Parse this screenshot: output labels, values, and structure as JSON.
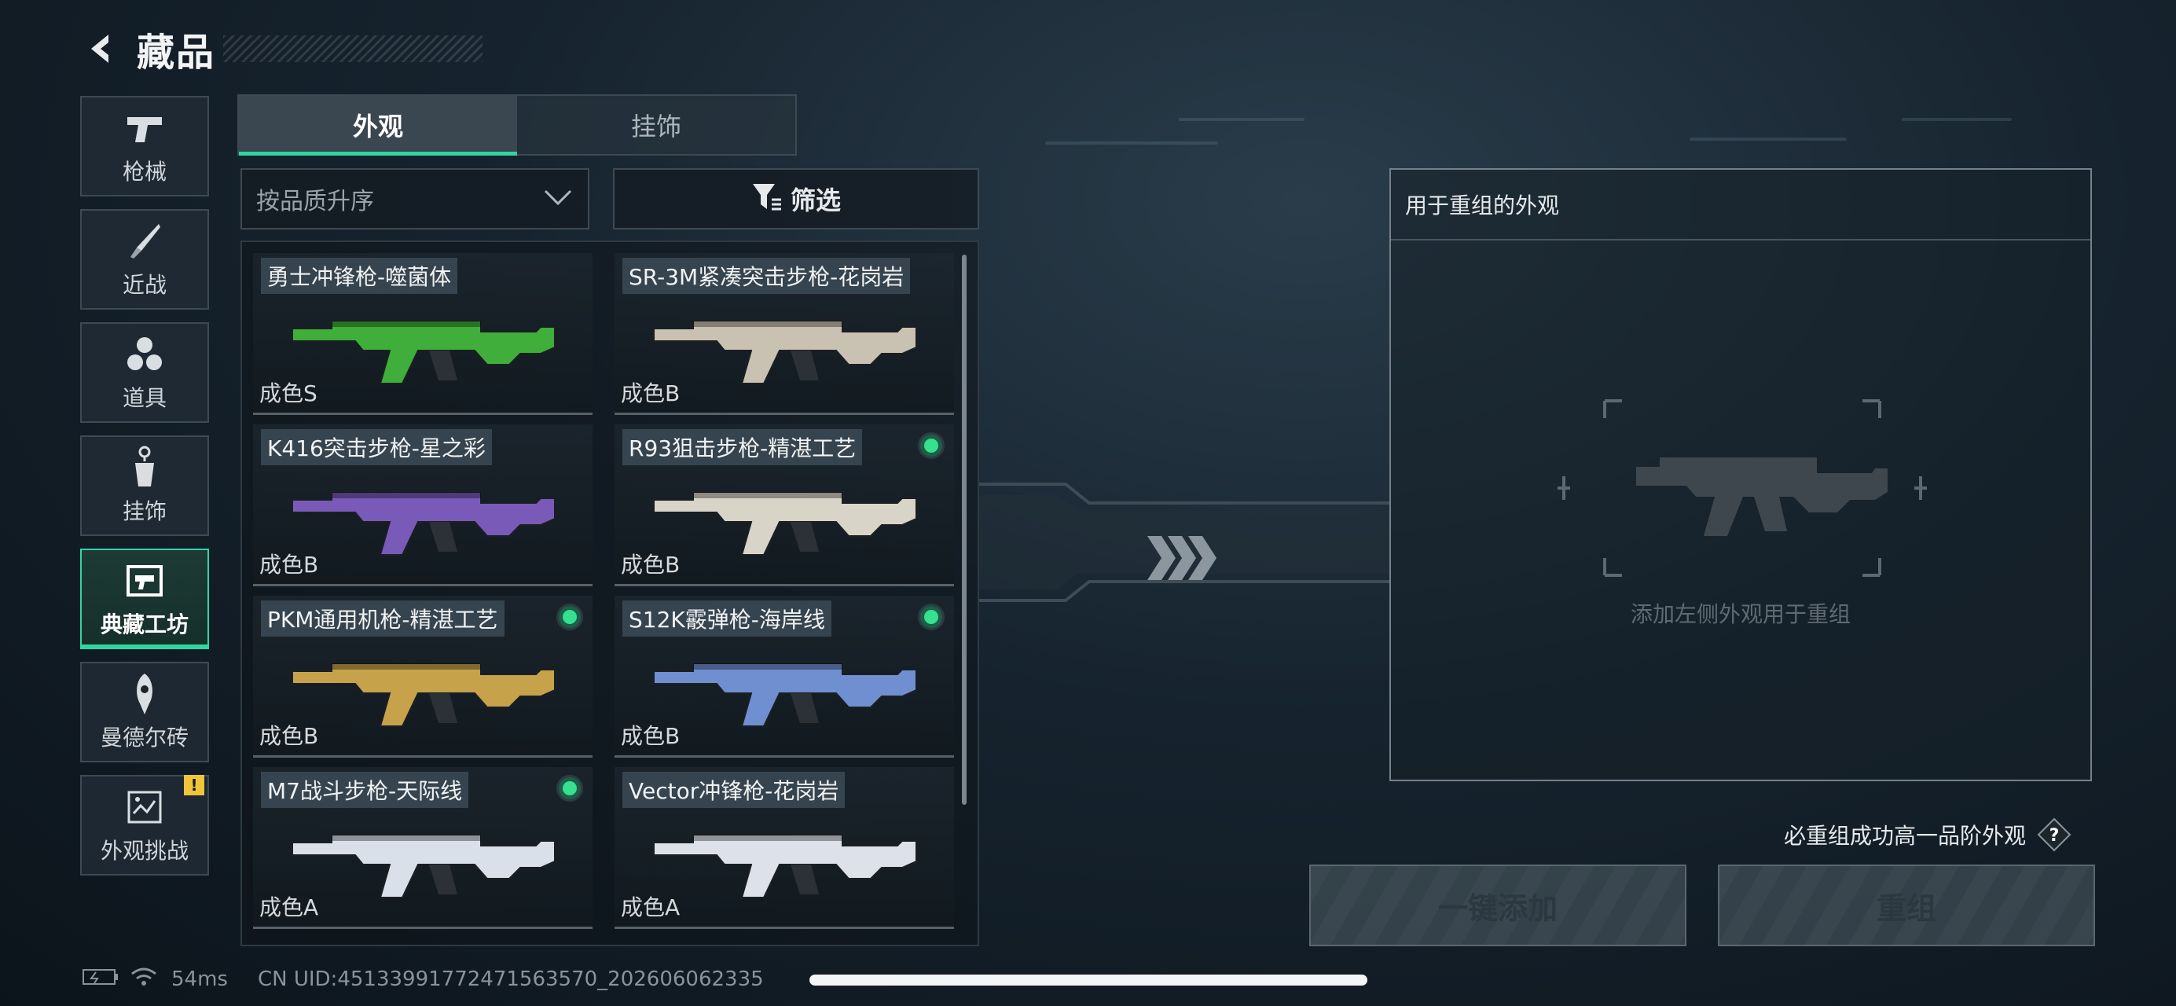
{
  "header": {
    "title": "藏品"
  },
  "rail": {
    "items": [
      {
        "label": "枪械",
        "icon": "pistol-icon"
      },
      {
        "label": "近战",
        "icon": "knife-icon"
      },
      {
        "label": "道具",
        "icon": "grenades-icon"
      },
      {
        "label": "挂饰",
        "icon": "charm-icon"
      },
      {
        "label": "典藏工坊",
        "icon": "workshop-icon",
        "active": true
      },
      {
        "label": "曼德尔砖",
        "icon": "mandel-brick-icon"
      },
      {
        "label": "外观挑战",
        "icon": "challenge-icon",
        "badge": "!"
      }
    ]
  },
  "tabs": [
    {
      "label": "外观",
      "active": true
    },
    {
      "label": "挂饰",
      "active": false
    }
  ],
  "sort": {
    "value": "按品质升序"
  },
  "filter": {
    "label": "筛选"
  },
  "items": [
    {
      "name": "勇士冲锋枪-噬菌体",
      "grade": "成色S",
      "dot": false,
      "skin": "#3fae3a"
    },
    {
      "name": "SR-3M紧凑突击步枪-花岗岩",
      "grade": "成色B",
      "dot": false,
      "skin": "#c9c2b2"
    },
    {
      "name": "K416突击步枪-星之彩",
      "grade": "成色B",
      "dot": false,
      "skin": "#7a5ab8"
    },
    {
      "name": "R93狙击步枪-精湛工艺",
      "grade": "成色B",
      "dot": true,
      "skin": "#d8d4c8"
    },
    {
      "name": "PKM通用机枪-精湛工艺",
      "grade": "成色B",
      "dot": true,
      "skin": "#c6a24a"
    },
    {
      "name": "S12K霰弹枪-海岸线",
      "grade": "成色B",
      "dot": true,
      "skin": "#6f8fd0"
    },
    {
      "name": "M7战斗步枪-天际线",
      "grade": "成色A",
      "dot": true,
      "skin": "#d9e0ea"
    },
    {
      "name": "Vector冲锋枪-花岗岩",
      "grade": "成色A",
      "dot": false,
      "skin": "#dde2ea"
    }
  ],
  "panel": {
    "title": "用于重组的外观",
    "hint": "添加左侧外观用于重组"
  },
  "guarantee": {
    "text": "必重组成功高一品阶外观",
    "help": "?"
  },
  "buttons": {
    "add": "一键添加",
    "reassemble": "重组"
  },
  "status": {
    "ping": "54ms",
    "uid": "CN UID:45133991772471563570_202606062335"
  },
  "colors": {
    "accent": "#2fd6a2",
    "dot": "#35e08f",
    "warn": "#f0c53a"
  }
}
